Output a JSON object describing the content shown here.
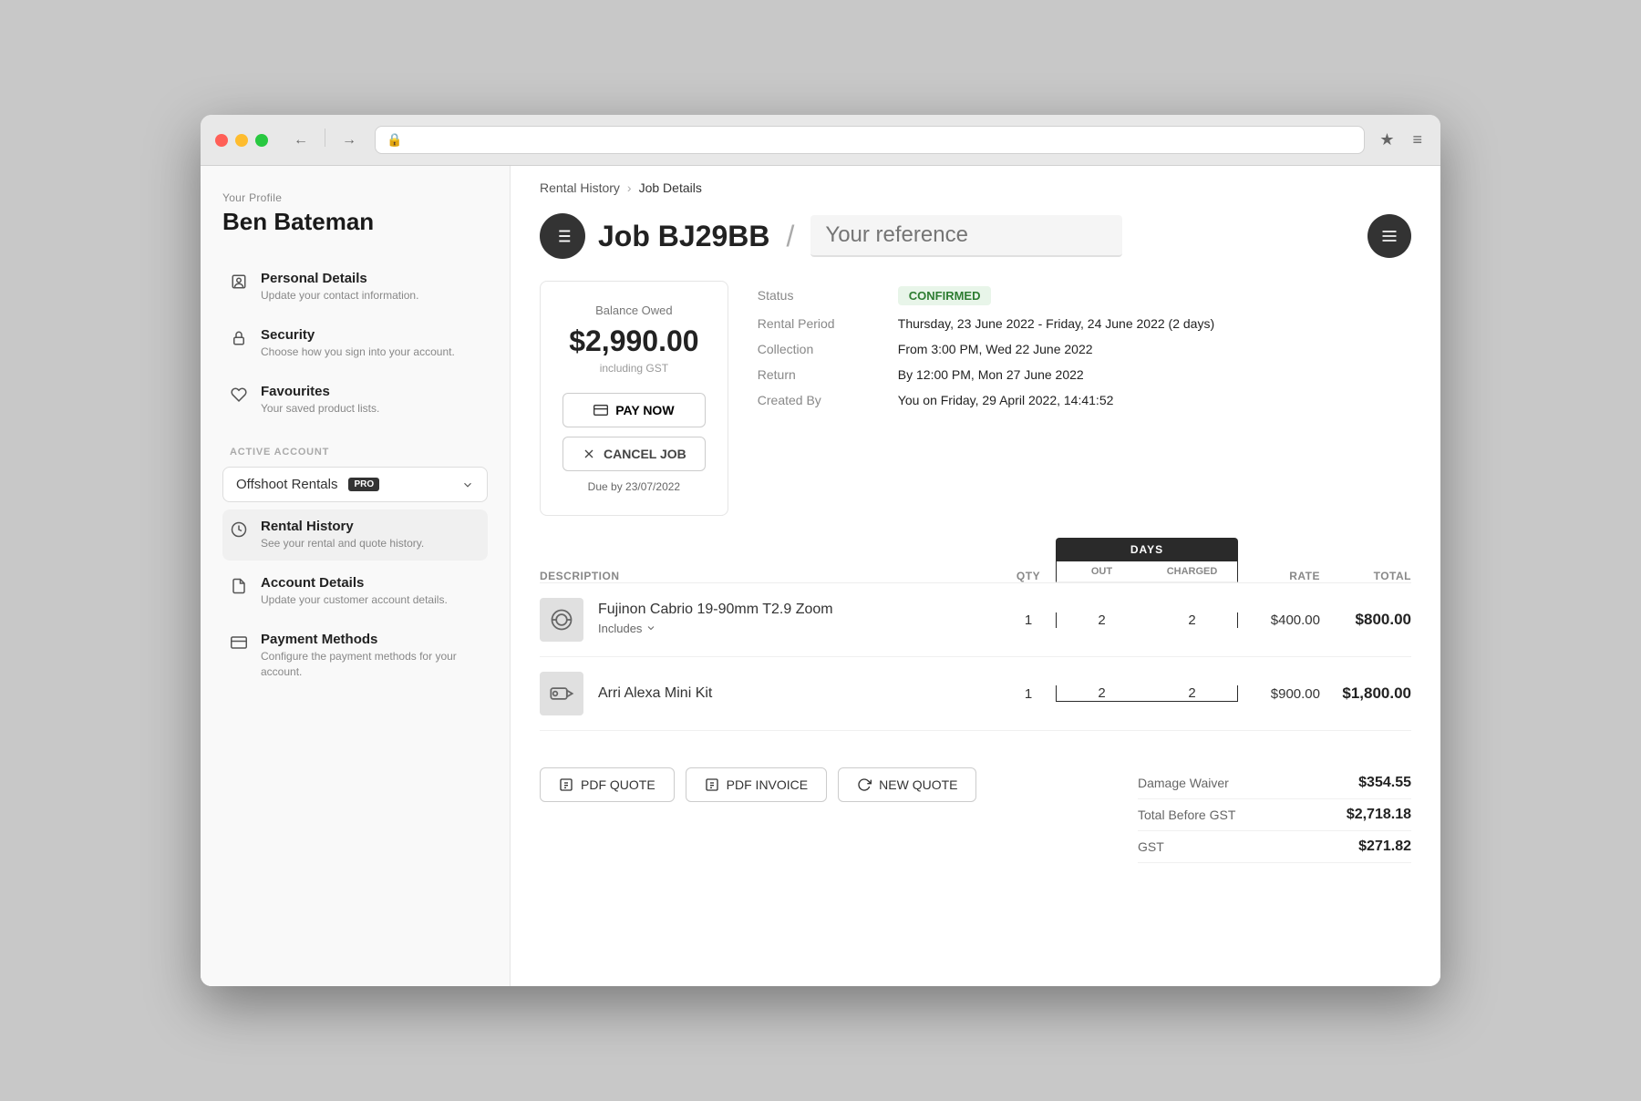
{
  "browser": {
    "back_btn": "←",
    "forward_btn": "→",
    "lock_icon": "🔒",
    "star_icon": "★",
    "menu_icon": "≡"
  },
  "sidebar": {
    "profile_label": "Your Profile",
    "username": "Ben Bateman",
    "nav_items": [
      {
        "id": "personal-details",
        "icon": "person",
        "title": "Personal Details",
        "subtitle": "Update your contact information."
      },
      {
        "id": "security",
        "icon": "lock",
        "title": "Security",
        "subtitle": "Choose how you sign into your account."
      },
      {
        "id": "favourites",
        "icon": "heart",
        "title": "Favourites",
        "subtitle": "Your saved product lists."
      }
    ],
    "active_account_label": "Active Account",
    "account_name": "Offshoot Rentals",
    "account_badge": "PRO",
    "account_items": [
      {
        "id": "rental-history",
        "icon": "history",
        "title": "Rental History",
        "subtitle": "See your rental and quote history.",
        "active": true
      },
      {
        "id": "account-details",
        "icon": "document",
        "title": "Account Details",
        "subtitle": "Update your customer account details."
      },
      {
        "id": "payment-methods",
        "icon": "card",
        "title": "Payment Methods",
        "subtitle": "Configure the payment methods for your account."
      }
    ]
  },
  "breadcrumb": {
    "rental_history": "Rental History",
    "separator": "›",
    "job_details": "Job Details"
  },
  "job": {
    "icon": "≡",
    "title": "Job BJ29BB",
    "separator": "/",
    "reference_placeholder": "Your reference",
    "menu_icon": "≡",
    "balance_label": "Balance Owed",
    "balance_amount": "$2,990.00",
    "balance_gst": "including GST",
    "pay_now_label": "PAY NOW",
    "cancel_label": "CANCEL JOB",
    "due_label": "Due by 23/07/2022",
    "status_label": "Status",
    "status_value": "CONFIRMED",
    "rental_period_label": "Rental Period",
    "rental_period_value": "Thursday, 23 June 2022 - Friday, 24 June 2022 (2 days)",
    "collection_label": "Collection",
    "collection_value": "From 3:00 PM, Wed 22 June 2022",
    "return_label": "Return",
    "return_value": "By 12:00 PM, Mon 27 June 2022",
    "created_label": "Created By",
    "created_value": "You on Friday, 29 April 2022, 14:41:52"
  },
  "table": {
    "col_description": "DESCRIPTION",
    "col_qty": "QTY",
    "col_days": "DAYS",
    "col_out": "OUT",
    "col_charged": "CHARGED",
    "col_rate": "RATE",
    "col_total": "TOTAL",
    "items": [
      {
        "name": "Fujinon Cabrio 19-90mm T2.9 Zoom",
        "includes_label": "Includes",
        "qty": 1,
        "out": 2,
        "charged": 2,
        "rate": "$400.00",
        "total": "$800.00"
      },
      {
        "name": "Arri Alexa Mini Kit",
        "includes_label": null,
        "qty": 1,
        "out": 2,
        "charged": 2,
        "rate": "$900.00",
        "total": "$1,800.00"
      }
    ]
  },
  "actions": {
    "pdf_quote": "PDF QUOTE",
    "pdf_invoice": "PDF INVOICE",
    "new_quote": "NEW QUOTE"
  },
  "totals": {
    "damage_waiver_label": "Damage Waiver",
    "damage_waiver_value": "$354.55",
    "total_before_gst_label": "Total Before GST",
    "total_before_gst_value": "$2,718.18",
    "gst_label": "GST",
    "gst_value": "$271.82"
  },
  "colors": {
    "status_green": "#2e7d32",
    "status_green_bg": "#e8f5e9",
    "dark": "#2a2a2a"
  }
}
